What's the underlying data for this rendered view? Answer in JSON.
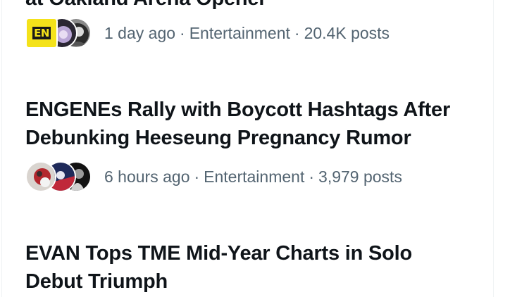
{
  "trends": [
    {
      "headline_lines": [
        "at Oakland Arena Opener"
      ],
      "avatar_badge": "EN",
      "time": "1 day ago",
      "category": "Entertainment",
      "posts": "20.4K posts"
    },
    {
      "headline_lines": [
        "ENGENEs Rally with Boycott Hashtags After",
        "Debunking Heeseung Pregnancy Rumor"
      ],
      "time": "6 hours ago",
      "category": "Entertainment",
      "posts": "3,979 posts"
    },
    {
      "headline_lines": [
        "EVAN Tops TME Mid-Year Charts in Solo",
        "Debut Triumph"
      ]
    }
  ],
  "separator": "·",
  "colors": {
    "text_primary": "#0f1419",
    "text_secondary": "#536471",
    "divider": "#eff3f4",
    "badge_yellow": "#f4e21a"
  }
}
